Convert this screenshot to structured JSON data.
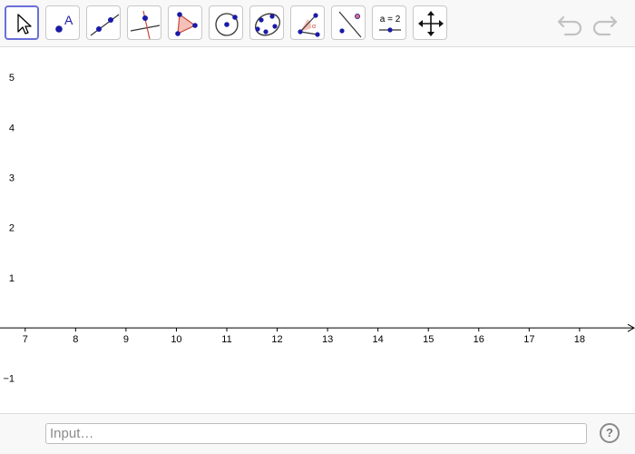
{
  "toolbar": {
    "tools": [
      {
        "name": "move-tool",
        "selected": true
      },
      {
        "name": "point-tool",
        "point_label": "A"
      },
      {
        "name": "line-tool"
      },
      {
        "name": "perpendicular-line-tool"
      },
      {
        "name": "polygon-tool"
      },
      {
        "name": "circle-center-point-tool"
      },
      {
        "name": "conic-through-five-points-tool"
      },
      {
        "name": "angle-tool",
        "angle_label": "α"
      },
      {
        "name": "reflect-about-line-tool"
      },
      {
        "name": "slider-tool",
        "slider_label": "a = 2"
      },
      {
        "name": "move-graphics-view-tool"
      }
    ],
    "undo_icon": "undo-icon",
    "redo_icon": "redo-icon"
  },
  "graphics": {
    "x_min": 6.5,
    "x_max": 19.1,
    "y_min": -1.7,
    "y_max": 5.6,
    "x_ticks": [
      7,
      8,
      9,
      10,
      11,
      12,
      13,
      14,
      15,
      16,
      17,
      18
    ],
    "y_ticks": [
      5,
      4,
      3,
      2,
      1,
      -1
    ],
    "y_tick_labels": [
      "5",
      "4",
      "3",
      "2",
      "1",
      "−1"
    ]
  },
  "input_bar": {
    "placeholder": "Input…",
    "help_label": "?"
  },
  "colors": {
    "accent": "#6b6fd9",
    "point": "#1a1aa8",
    "polygon_fill": "#f4c0b8",
    "polygon_stroke": "#c8483c"
  }
}
